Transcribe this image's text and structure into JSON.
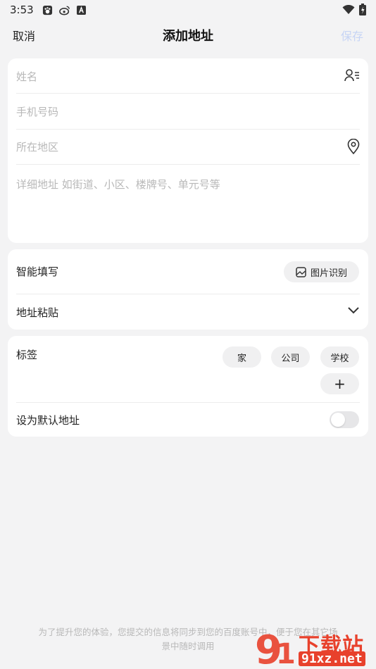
{
  "status": {
    "time": "3:53"
  },
  "nav": {
    "cancel": "取消",
    "title": "添加地址",
    "save": "保存"
  },
  "form": {
    "name_placeholder": "姓名",
    "phone_placeholder": "手机号码",
    "region_placeholder": "所在地区",
    "detail_placeholder": "详细地址  如街道、小区、楼牌号、单元号等"
  },
  "smart": {
    "label": "智能填写",
    "image_button": "图片识别",
    "paste_label": "地址粘贴"
  },
  "tags": {
    "label": "标签",
    "items": [
      "家",
      "公司",
      "学校"
    ],
    "add": "+"
  },
  "default": {
    "label": "设为默认地址",
    "enabled": false
  },
  "footer": {
    "line1": "为了提升您的体验，您提交的信息将同步到您的百度账号中，便于您在其它场",
    "line2": "景中随时调用"
  },
  "watermark": {
    "brand": "下载站",
    "site": "91xz.net"
  },
  "colors": {
    "save_disabled": "#c6d4f5",
    "background": "#f3f3f4",
    "watermark_red": "#e8412c"
  }
}
